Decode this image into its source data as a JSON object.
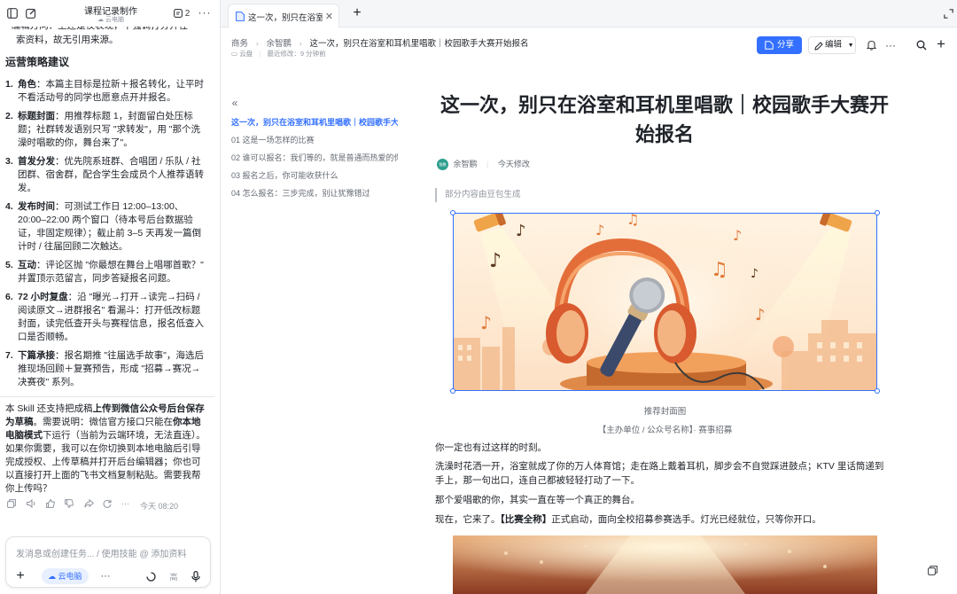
{
  "left_header": {
    "title": "课程记录制作",
    "sub": "云电脑",
    "badge_count": "2"
  },
  "left_body": {
    "cut_line_1": "编辑方向：上还是仅表现，不强调打分并在",
    "cut_line_2": "索资料，故无引用来源。",
    "section_title": "运营策略建议",
    "items": [
      {
        "n": "1.",
        "head": "角色",
        "text": "：本篇主目标是拉新＋报名转化，让平时不看活动号的同学也愿意点开并报名。"
      },
      {
        "n": "2.",
        "head": "标题封面",
        "text": "：用推荐标题 1，封面留白处压标题；社群转发语别只写 \"求转发\"，用 \"那个洗澡时唱歌的你，舞台来了\"。"
      },
      {
        "n": "3.",
        "head": "首发分发",
        "text": "：优先院系班群、合唱团 / 乐队 / 社团群、宿舍群，配合学生会成员个人推荐语转发。"
      },
      {
        "n": "4.",
        "head": "发布时间",
        "text": "：可测试工作日 12:00–13:00、20:00–22:00 两个窗口（待本号后台数据验证，非固定规律）；截止前 3–5 天再发一篇倒计时 / 往届回顾二次触达。"
      },
      {
        "n": "5.",
        "head": "互动",
        "text": "：评论区抛 \"你最想在舞台上唱哪首歌？\" 并置顶示范留言，同步答疑报名问题。"
      },
      {
        "n": "6.",
        "head": "72 小时复盘",
        "text": "：沿 \"曝光→打开→读完→扫码 / 阅读原文→进群报名\" 看漏斗：打开低改标题封面，读完低查开头与赛程信息，报名低查入口是否顺畅。"
      },
      {
        "n": "7.",
        "head": "下篇承接",
        "text": "：报名期推 \"往届选手故事\"，海选后推现场回顾＋复赛预告，形成 \"招募→赛况→决赛夜\" 系列。"
      }
    ],
    "note_plain_1": "本 Skill 还支持把成稿",
    "note_bold_1": "上传到微信公众号后台保存为草稿",
    "note_plain_2": "。需要说明：微信官方接口只能在",
    "note_bold_2": "你本地电脑模式",
    "note_plain_3": "下运行（当前为云端环境，无法直连）。如果你需要，我可以在你切换到本地电脑后引导完成授权、上传草稿并打开后台编辑器；你也可以直接打开上面的飞书文档复制粘贴。需要我帮你上传吗？",
    "time": "今天 08:20"
  },
  "input": {
    "placeholder": "发消息或创建任务... / 使用技能 @ 添加资料",
    "cloud_label": "云电脑",
    "mode_label": "高"
  },
  "tab": {
    "title": "这一次，别只在浴室和耳机里唱歌｜校园歌手大赛开始报名"
  },
  "breadcrumb": {
    "a": "商务",
    "b": "余智鹏",
    "c": "这一次，别只在浴室和耳机里唱歌｜校园歌手大赛开始报名"
  },
  "meta": {
    "loc": "云盘",
    "edited": "最近修改：9 分钟前"
  },
  "toolbar": {
    "share": "分享",
    "edit": "编辑"
  },
  "toc": [
    "这一次，别只在浴室和耳机里唱歌｜校园歌手大赛开始报名",
    "01 这是一场怎样的比赛",
    "02 谁可以报名：我们等的，就是普通而热爱的你",
    "03 报名之后，你可能收获什么",
    "04 怎么报名：三步完成，别让犹豫错过"
  ],
  "doc": {
    "title": "这一次，别只在浴室和耳机里唱歌｜校园歌手大赛开始报名",
    "author_badge": "智鹏",
    "author": "余智鹏",
    "modified": "今天修改",
    "quote": "部分内容由豆包生成",
    "caption1": "推荐封面图",
    "caption2": "【主办单位 / 公众号名称】· 赛事招募",
    "p1": "你一定也有过这样的时刻。",
    "p2": "洗澡时花洒一开，浴室就成了你的万人体育馆；走在路上戴着耳机，脚步会不自觉踩进鼓点；KTV 里话筒递到手上，那一句出口，连自己都被轻轻打动了一下。",
    "p3": "那个爱唱歌的你，其实一直在等一个真正的舞台。",
    "p4_plain_1": "现在，它来了。",
    "p4_bold": "【比赛全称】",
    "p4_plain_2": "正式启动，面向全校招募参赛选手。灯光已经就位，只等你开口。"
  }
}
